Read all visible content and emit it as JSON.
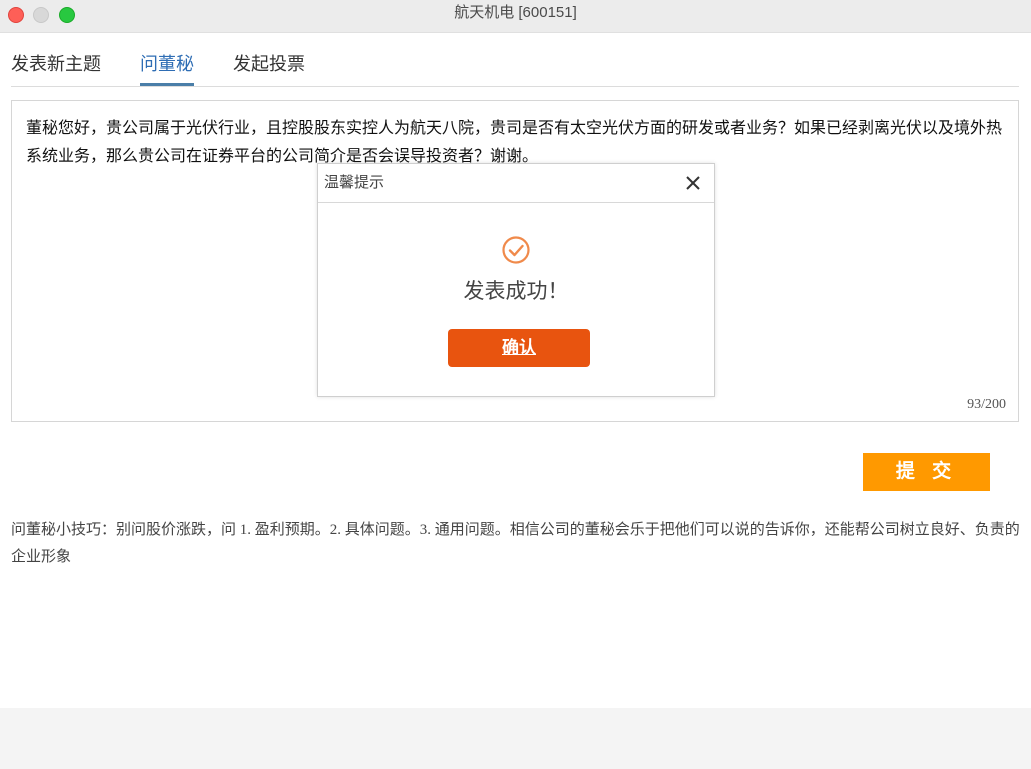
{
  "window": {
    "title": "航天机电 [600151]"
  },
  "tabs": [
    {
      "label": "发表新主题",
      "active": false
    },
    {
      "label": "问董秘",
      "active": true
    },
    {
      "label": "发起投票",
      "active": false
    }
  ],
  "question": {
    "text": "董秘您好，贵公司属于光伏行业，且控股股东实控人为航天八院，贵司是否有太空光伏方面的研发或者业务？如果已经剥离光伏以及境外热系统业务，那么贵公司在证券平台的公司简介是否会误导投资者？谢谢。",
    "char_count": "93/200"
  },
  "submit_label": "提 交",
  "tips": "问董秘小技巧：别问股价涨跌，问 1. 盈利预期。2. 具体问题。3. 通用问题。相信公司的董秘会乐于把他们可以说的告诉你，还能帮公司树立良好、负责的企业形象",
  "modal": {
    "title": "温馨提示",
    "message": "发表成功！",
    "confirm_label": "确认"
  },
  "colors": {
    "accent_tab": "#2e6db4",
    "submit_bg": "#ff9900",
    "confirm_bg": "#e8540f",
    "success_icon": "#f08a4b"
  },
  "icons": {
    "close": "close-icon",
    "success": "check-circle-icon"
  }
}
